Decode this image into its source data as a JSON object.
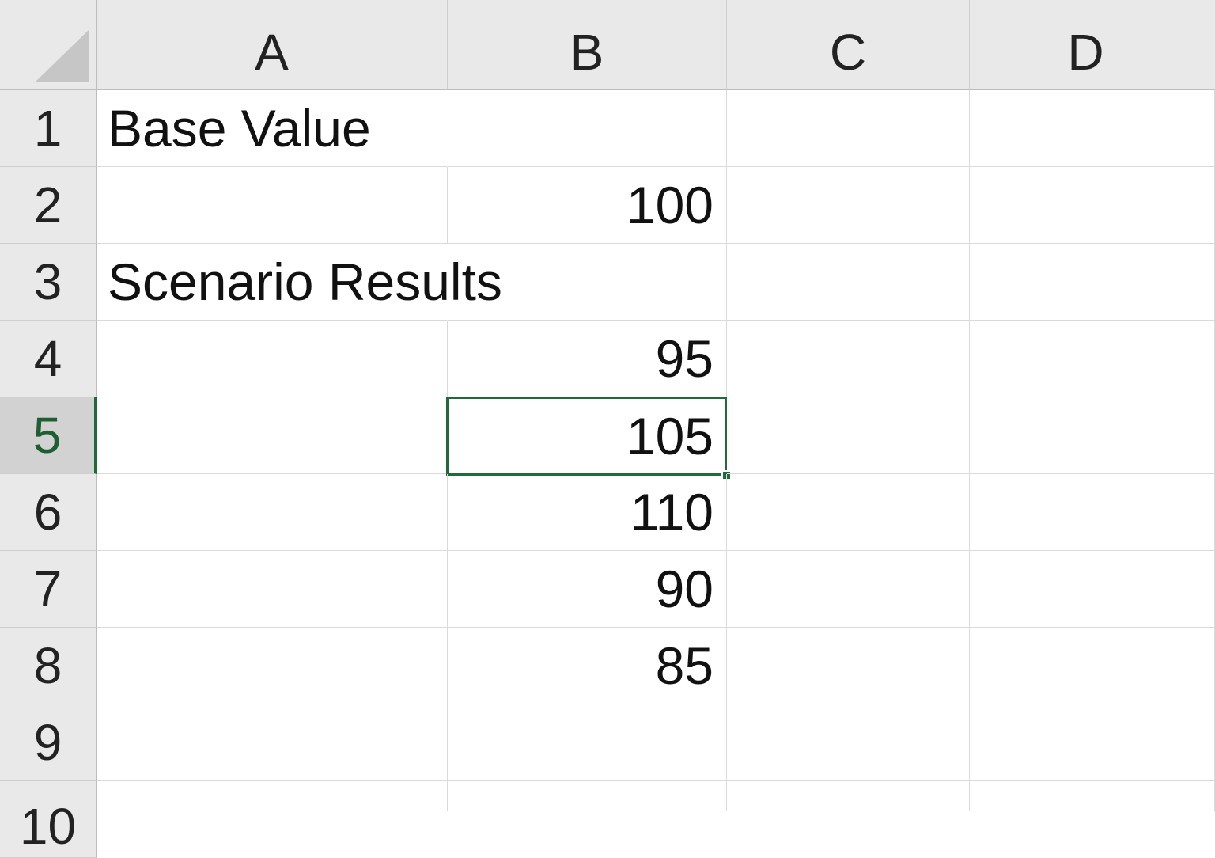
{
  "columns": [
    "A",
    "B",
    "C",
    "D"
  ],
  "rows": [
    "1",
    "2",
    "3",
    "4",
    "5",
    "6",
    "7",
    "8",
    "9",
    "10"
  ],
  "active_row": "5",
  "selected_cell": "B5",
  "cells": {
    "A1": "Base Value",
    "B2": "100",
    "A3": "Scenario Results",
    "B4": "95",
    "B5": "105",
    "B6": "110",
    "B7": "90",
    "B8": "85"
  },
  "colors": {
    "header_bg": "#e9e9e9",
    "selection": "#1f6b3a",
    "gridline": "#dadada"
  }
}
